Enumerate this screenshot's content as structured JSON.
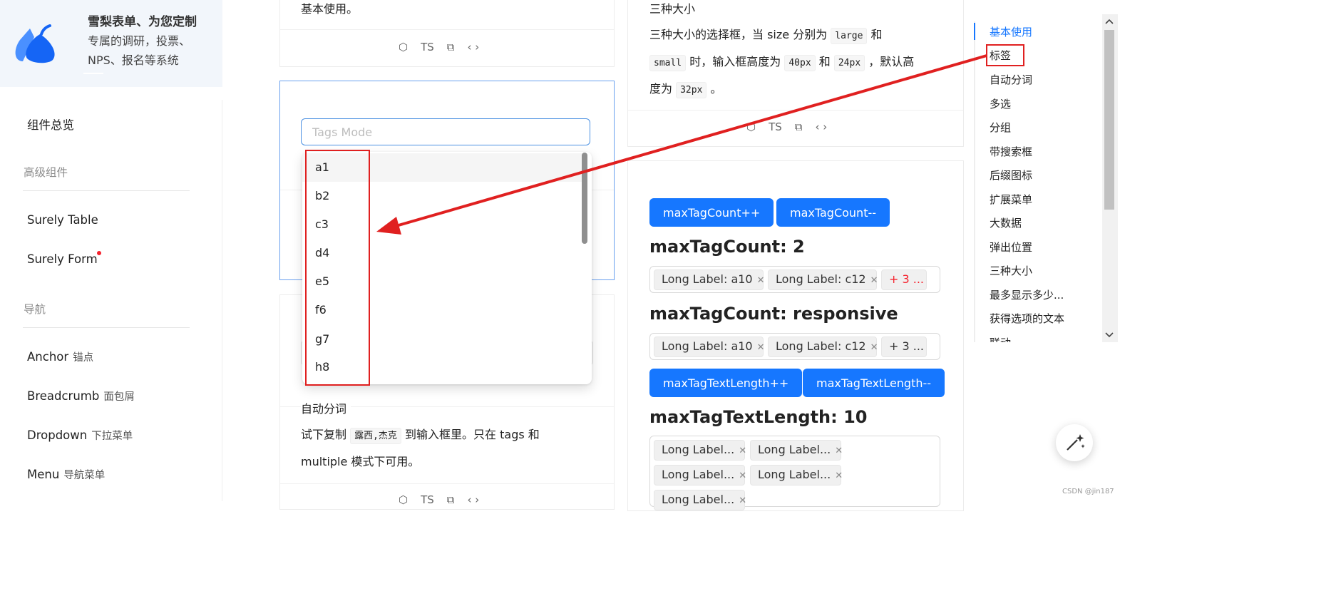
{
  "brand": {
    "title": "雪梨表单、为您定制",
    "subtitle": "专属的调研，投票、NPS、报名等系统"
  },
  "sidebar": {
    "overview": "组件总览",
    "groups": [
      {
        "title": "高级组件",
        "items": [
          {
            "label": "Surely Table",
            "sub": ""
          },
          {
            "label": "Surely Form",
            "sub": "",
            "dot": true
          }
        ]
      },
      {
        "title": "导航",
        "items": [
          {
            "label": "Anchor",
            "sub": "锚点"
          },
          {
            "label": "Breadcrumb",
            "sub": "面包屑"
          },
          {
            "label": "Dropdown",
            "sub": "下拉菜单"
          },
          {
            "label": "Menu",
            "sub": "导航菜单"
          }
        ]
      }
    ]
  },
  "left_column": {
    "top_card_text": "基本使用。",
    "toolbar": {
      "ts": "TS"
    },
    "tags_input": {
      "placeholder": "Tags Mode",
      "value": ""
    },
    "dropdown_options": [
      "a1",
      "b2",
      "c3",
      "d4",
      "e5",
      "f6",
      "g7",
      "h8"
    ],
    "auto_token": {
      "title": "自动分词",
      "text_before": "试下复制",
      "code": "露西,杰克",
      "text_after": "到输入框里。只在 tags 和",
      "line2": "multiple 模式下可用。"
    }
  },
  "right_column": {
    "sizes": {
      "title": "三种大小",
      "line1_a": "三种大小的选择框，当 size 分别为",
      "code_large": "large",
      "line1_b": "和",
      "code_small": "small",
      "line2_a": "时，输入框高度为",
      "code_40": "40px",
      "line2_b": "和",
      "code_24": "24px",
      "line2_c": "，默认高",
      "line3_a": "度为",
      "code_32": "32px",
      "line3_b": "。"
    },
    "buttons": {
      "inc_count": "maxTagCount++",
      "dec_count": "maxTagCount--",
      "inc_length": "maxTagTextLength++",
      "dec_length": "maxTagTextLength--"
    },
    "heading_count": "maxTagCount: 2",
    "select_count_tags": [
      "Long Label: a10",
      "Long Label: c12"
    ],
    "select_count_more": "+ 3 ...",
    "heading_responsive": "maxTagCount: responsive",
    "select_resp_tags": [
      "Long Label: a10",
      "Long Label: c12"
    ],
    "select_resp_more": "+ 3 ...",
    "heading_length": "maxTagTextLength: 10",
    "select_len_tags": [
      "Long Label...",
      "Long Label...",
      "Long Label...",
      "Long Label...",
      "Long Label..."
    ]
  },
  "anchor_nav": {
    "items": [
      "基本使用",
      "标签",
      "自动分词",
      "多选",
      "分组",
      "带搜索框",
      "后缀图标",
      "扩展菜单",
      "大数据",
      "弹出位置",
      "三种大小",
      "最多显示多少...",
      "获得选项的文本",
      "联动"
    ],
    "active_index": 0
  },
  "colors": {
    "primary": "#1677ff",
    "annotation_red": "#e02020",
    "tag_more_red": "#f5222d"
  },
  "watermark": "CSDN @jin187"
}
